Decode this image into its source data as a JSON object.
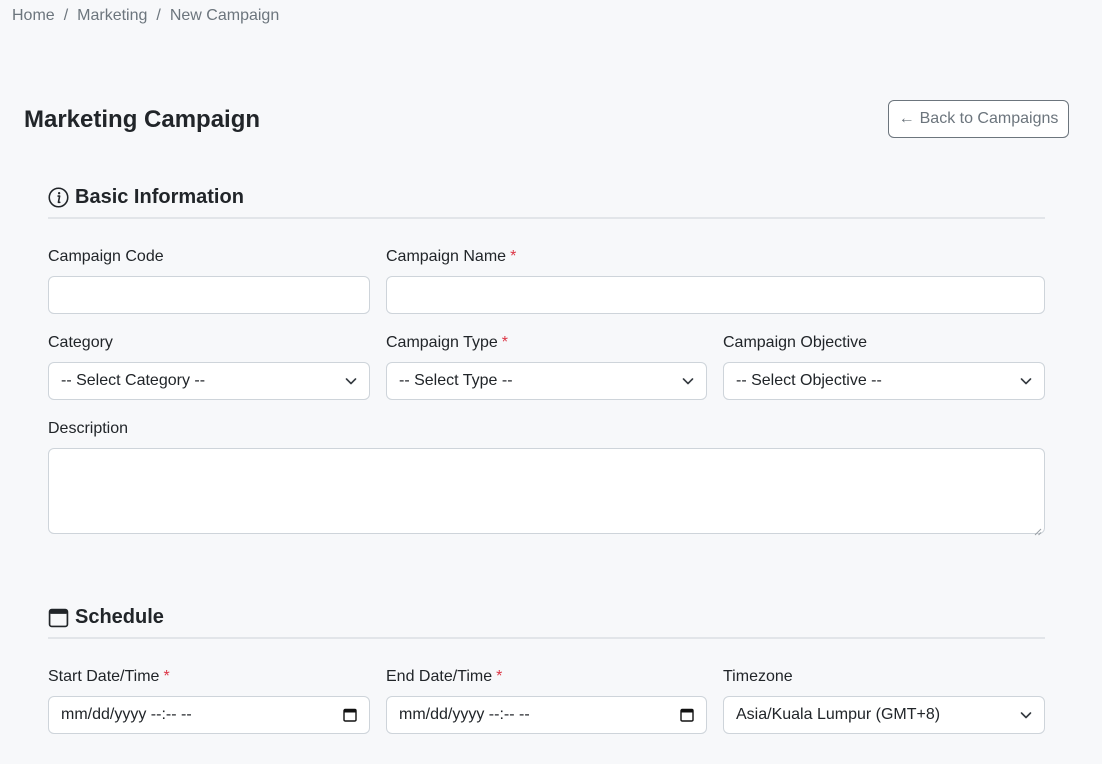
{
  "breadcrumb": {
    "home": "Home",
    "marketing": "Marketing",
    "current": "New Campaign",
    "separator": "/"
  },
  "page": {
    "title": "Marketing Campaign",
    "back_label": "Back to Campaigns",
    "back_arrow": "←"
  },
  "basic": {
    "heading": "Basic Information",
    "campaign_code": {
      "label": "Campaign Code",
      "value": ""
    },
    "campaign_name": {
      "label": "Campaign Name",
      "value": "",
      "required": "*"
    },
    "category": {
      "label": "Category",
      "selected": "-- Select Category --"
    },
    "campaign_type": {
      "label": "Campaign Type",
      "selected": "-- Select Type --",
      "required": "*"
    },
    "objective": {
      "label": "Campaign Objective",
      "selected": "-- Select Objective --"
    },
    "description": {
      "label": "Description",
      "value": ""
    }
  },
  "schedule": {
    "heading": "Schedule",
    "start": {
      "label": "Start Date/Time",
      "placeholder": "mm/dd/yyyy --:-- --",
      "required": "*"
    },
    "end": {
      "label": "End Date/Time",
      "placeholder": "mm/dd/yyyy --:-- --",
      "required": "*"
    },
    "timezone": {
      "label": "Timezone",
      "selected": "Asia/Kuala Lumpur (GMT+8)"
    }
  },
  "icons": {
    "info": "info-circle-icon",
    "calendar": "calendar-icon",
    "chevron": "chevron-down-icon"
  },
  "colors": {
    "required": "#dc3545",
    "border": "#ced4da",
    "muted": "#6c757d"
  }
}
